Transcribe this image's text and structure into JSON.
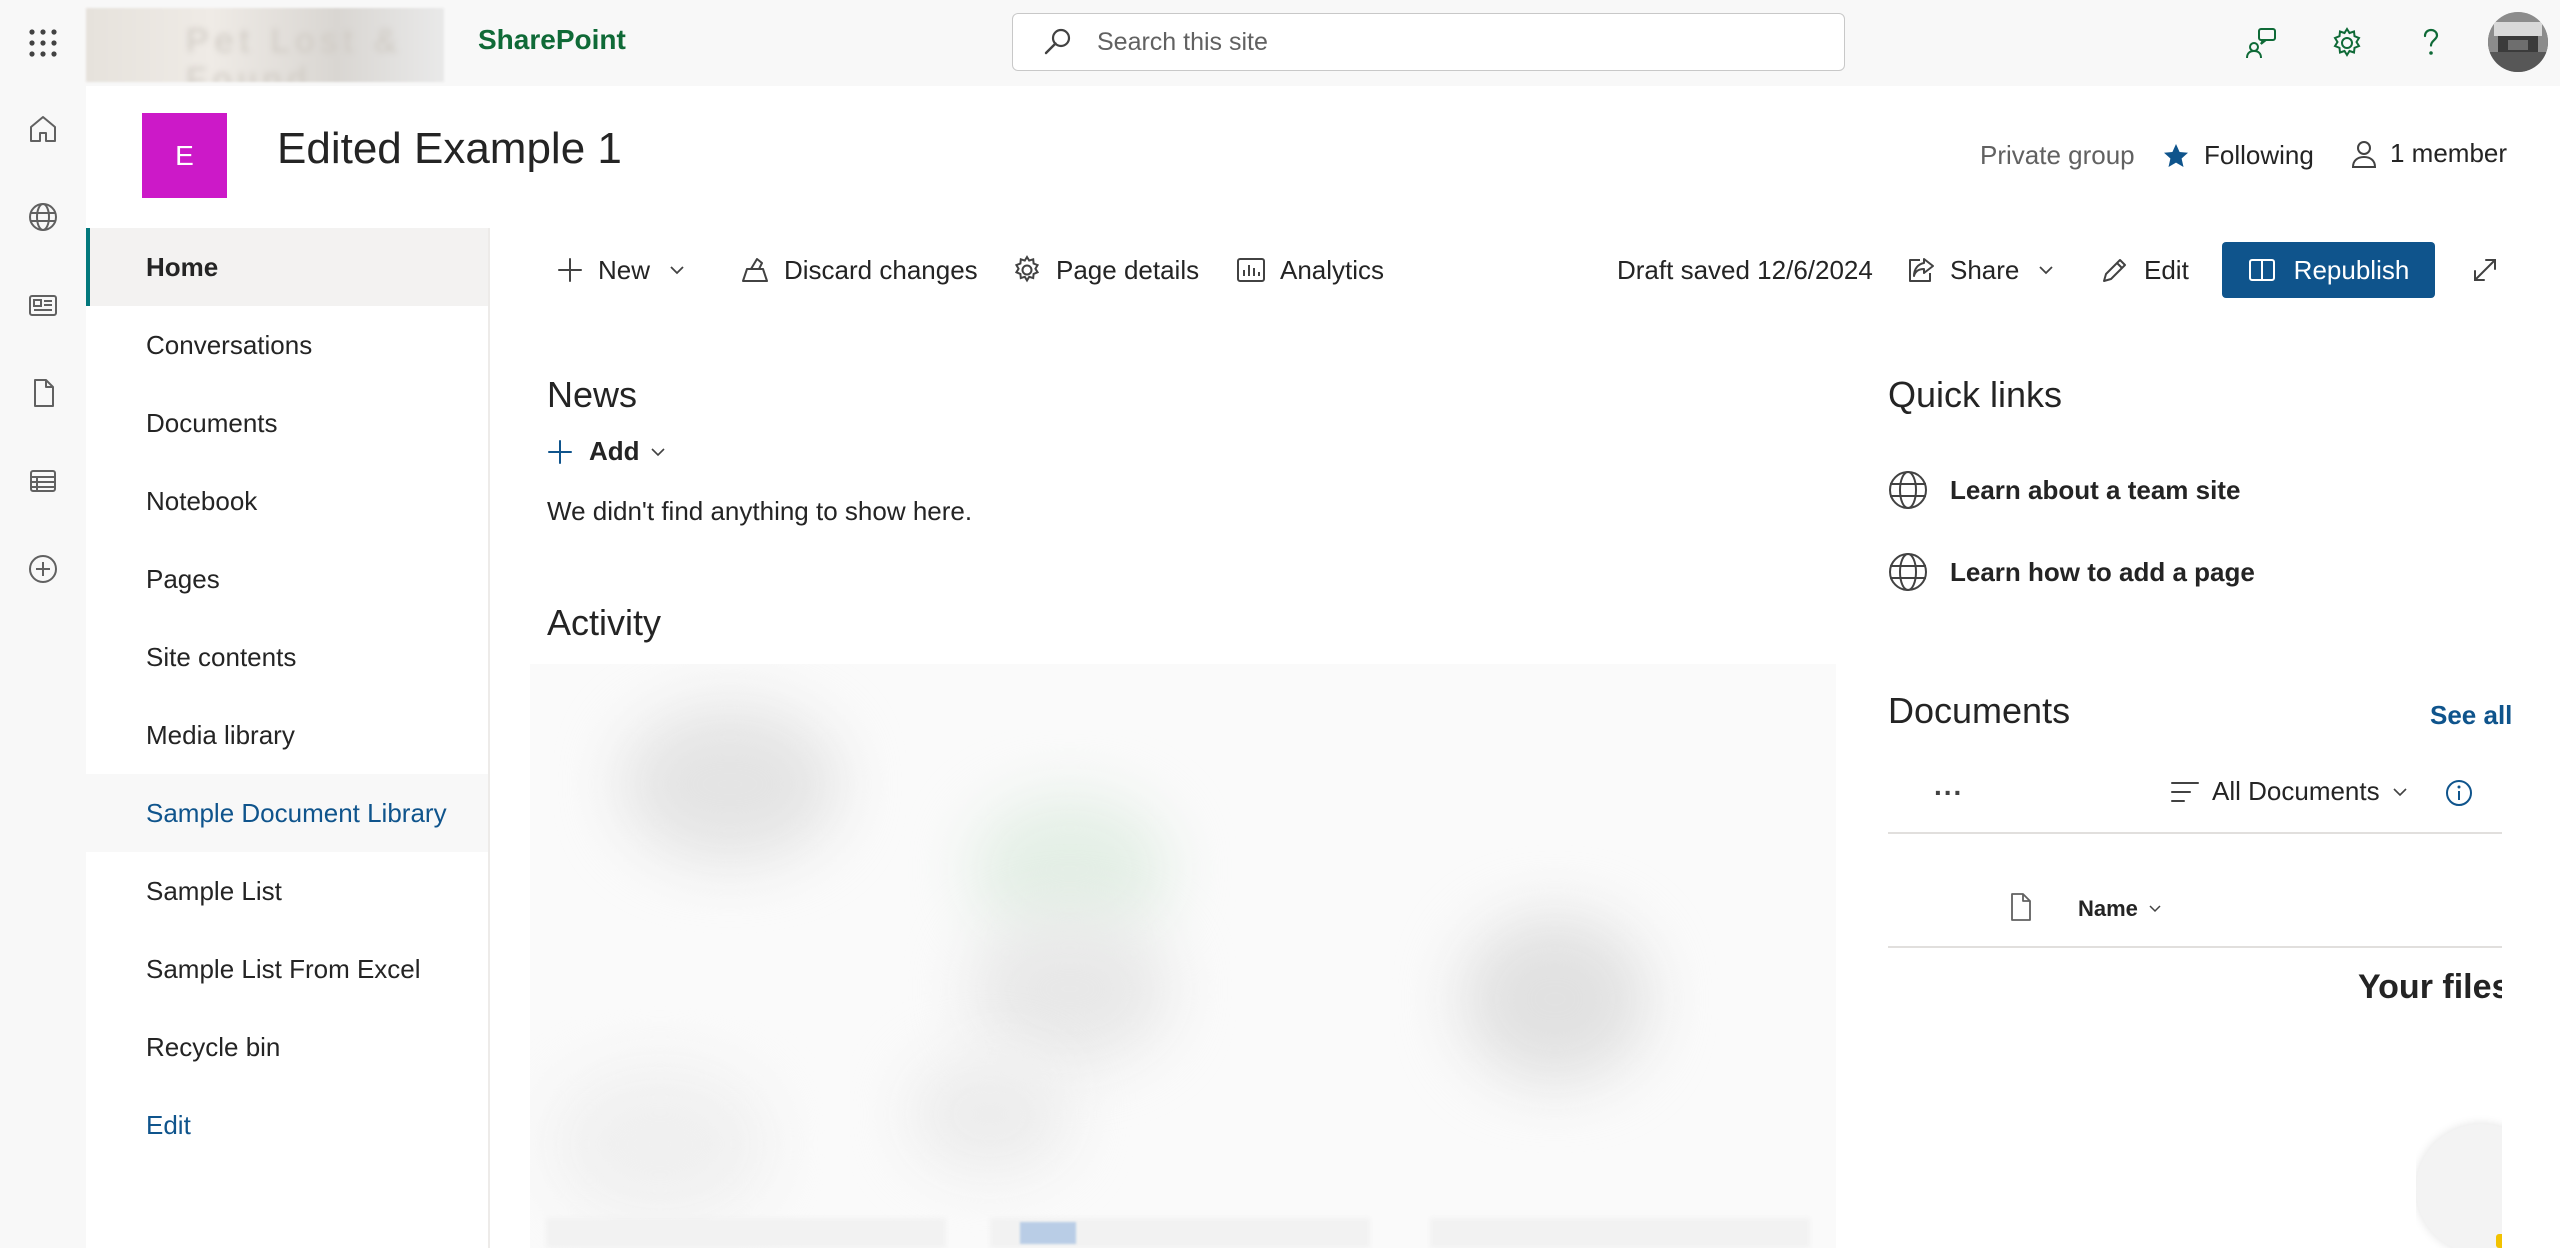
{
  "suite": {
    "app_name": "SharePoint",
    "tenant_logo_text": "Pet Lost & Found",
    "search_placeholder": "Search this site"
  },
  "site": {
    "logo_letter": "E",
    "logo_color": "#cc19c8",
    "title": "Edited Example 1",
    "privacy": "Private group",
    "following_label": "Following",
    "members_label": "1 member"
  },
  "nav": {
    "items": [
      {
        "label": "Home",
        "state": "selected"
      },
      {
        "label": "Conversations"
      },
      {
        "label": "Documents"
      },
      {
        "label": "Notebook"
      },
      {
        "label": "Pages"
      },
      {
        "label": "Site contents"
      },
      {
        "label": "Media library"
      },
      {
        "label": "Sample Document Library",
        "state": "hovered"
      },
      {
        "label": "Sample List"
      },
      {
        "label": "Sample List From Excel"
      },
      {
        "label": "Recycle bin"
      }
    ],
    "edit_label": "Edit"
  },
  "commandbar": {
    "new_label": "New",
    "discard_label": "Discard changes",
    "page_details_label": "Page details",
    "analytics_label": "Analytics",
    "draft_status": "Draft saved 12/6/2024",
    "share_label": "Share",
    "edit_label": "Edit",
    "republish_label": "Republish"
  },
  "news": {
    "title": "News",
    "add_label": "Add",
    "empty_message": "We didn't find anything to show here."
  },
  "activity": {
    "title": "Activity"
  },
  "quick_links": {
    "title": "Quick links",
    "items": [
      {
        "label": "Learn about a team site",
        "icon": "globe-icon"
      },
      {
        "label": "Learn how to add a page",
        "icon": "globe-icon"
      }
    ]
  },
  "documents_webpart": {
    "title": "Documents",
    "see_all_label": "See all",
    "more_label": "...",
    "view_label": "All Documents",
    "column_name": "Name",
    "empty_title": "Your files"
  },
  "colors": {
    "brand_green": "#0f6a37",
    "primary_blue": "#0f548c",
    "selected_accent": "#03787c"
  }
}
